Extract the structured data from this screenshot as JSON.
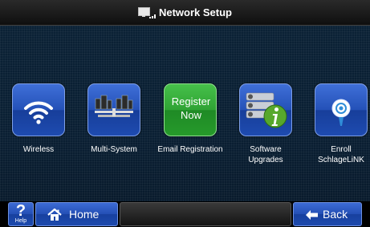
{
  "header": {
    "title": "Network Setup",
    "icon": "network-computer-icon"
  },
  "tiles": [
    {
      "label": "Wireless",
      "icon": "wifi-icon"
    },
    {
      "label": "Multi-System",
      "icon": "multi-system-icon"
    },
    {
      "label": "Email Registration",
      "tile_text_line1": "Register",
      "tile_text_line2": "Now"
    },
    {
      "label_line1": "Software",
      "label_line2": "Upgrades",
      "icon": "software-info-icon"
    },
    {
      "label_line1": "Enroll",
      "label_line2": "SchlageLiNK",
      "icon": "schlage-link-icon"
    }
  ],
  "footer": {
    "help_symbol": "?",
    "help_label": "Help",
    "home_label": "Home",
    "back_label": "Back"
  },
  "colors": {
    "tile_blue": "#2451b8",
    "tile_green": "#2fa334",
    "background": "#0a1f33"
  }
}
